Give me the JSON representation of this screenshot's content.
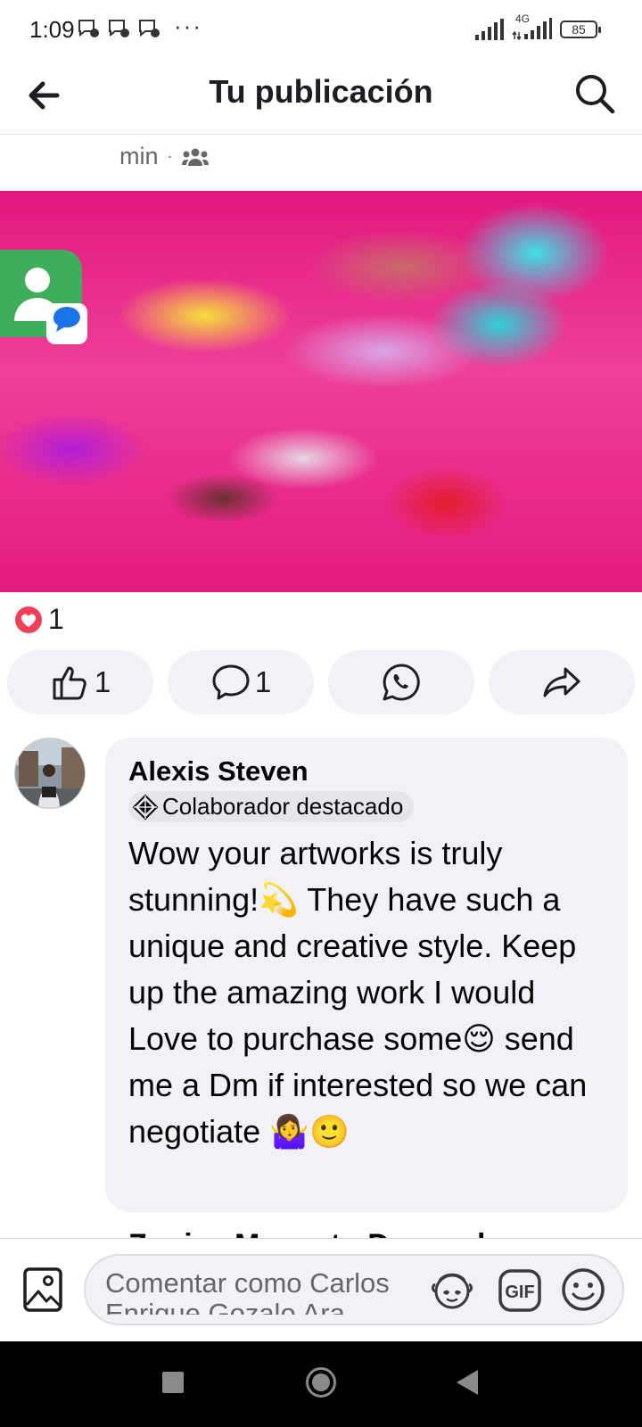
{
  "status_bar": {
    "time": "1:09",
    "more": "···",
    "network_type": "4G",
    "battery_percent": "85"
  },
  "header": {
    "title": "Tu publicación"
  },
  "post": {
    "time_label": "min",
    "separator": "·",
    "reaction_count": "1",
    "like_count": "1",
    "comment_count": "1"
  },
  "comment": {
    "author": "Alexis Steven",
    "badge": "Colaborador destacado",
    "text": "Wow your artworks is truly stunning!💫 They have such a unique and creative style. Keep up the amazing work I would Love to purchase some😌 send me a Dm if interested so we can negotiate 🤷‍♀️🙂"
  },
  "next_comment_partial": "Zonica Moncato Dananak",
  "composer": {
    "placeholder": "Comentar como Carlos Enrique Gozalo Ara"
  },
  "colors": {
    "accent_text": "#65676b",
    "bubble_bg": "#f0f2f5",
    "heart_red": "#f33e58"
  }
}
